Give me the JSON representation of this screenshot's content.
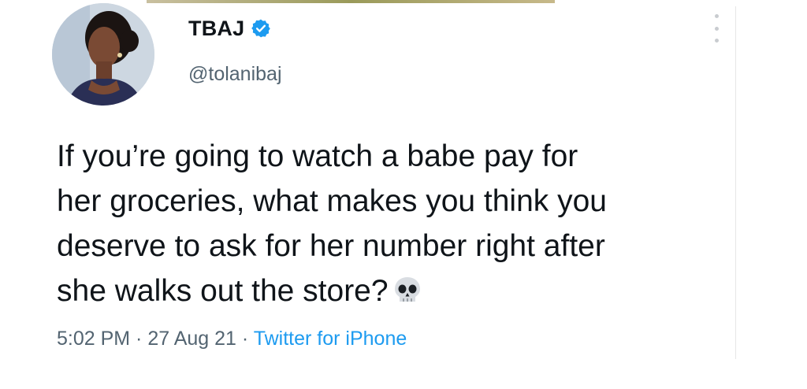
{
  "tweet": {
    "display_name": "TBAJ",
    "handle": "@tolanibaj",
    "verified": true,
    "text_lines": [
      "If you’re going to watch a babe pay for",
      "her groceries, what makes you think you",
      "deserve to ask for her number right after",
      "she walks out the store?"
    ],
    "emoji": "skull-icon",
    "time": "5:02 PM",
    "separator": " · ",
    "date": "27 Aug 21",
    "source": "Twitter for iPhone"
  },
  "colors": {
    "text": "#0f1419",
    "muted": "#536471",
    "accent": "#1d9bf0"
  },
  "icons": {
    "verified": "verified-badge-icon",
    "more": "more-options-icon",
    "emoji": "skull-icon"
  }
}
